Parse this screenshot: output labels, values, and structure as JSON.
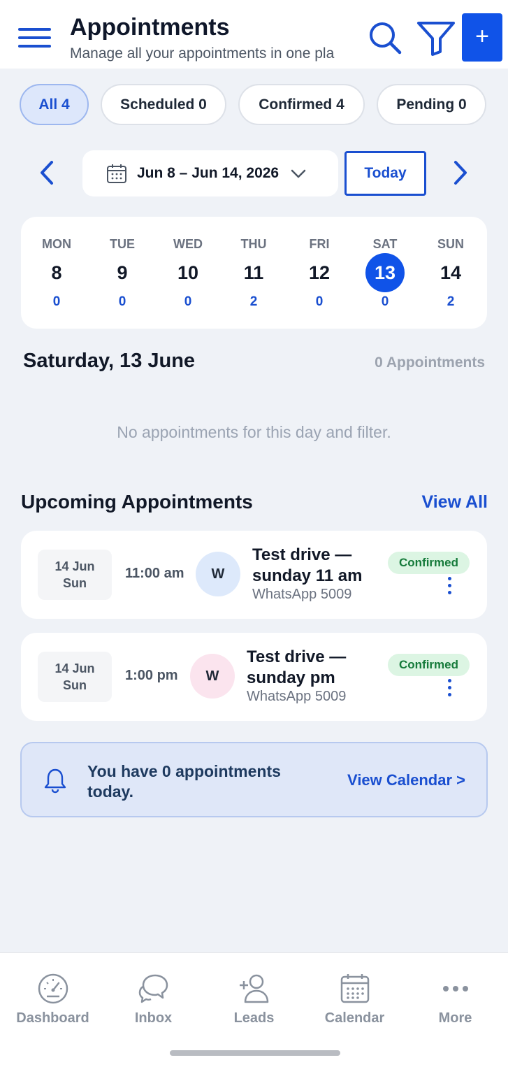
{
  "header": {
    "title": "Appointments",
    "subtitle": "Manage all your appointments in one pla",
    "add_label": "+"
  },
  "filters": [
    {
      "label": "All 4",
      "active": true
    },
    {
      "label": "Scheduled 0",
      "active": false
    },
    {
      "label": "Confirmed 4",
      "active": false
    },
    {
      "label": "Pending 0",
      "active": false
    }
  ],
  "date_nav": {
    "range": "Jun 8 – Jun 14, 2026",
    "today_label": "Today"
  },
  "week": [
    {
      "name": "MON",
      "num": "8",
      "count": "0"
    },
    {
      "name": "TUE",
      "num": "9",
      "count": "0"
    },
    {
      "name": "WED",
      "num": "10",
      "count": "0"
    },
    {
      "name": "THU",
      "num": "11",
      "count": "2"
    },
    {
      "name": "FRI",
      "num": "12",
      "count": "0"
    },
    {
      "name": "SAT",
      "num": "13",
      "count": "0",
      "selected": true
    },
    {
      "name": "SUN",
      "num": "14",
      "count": "2"
    }
  ],
  "selected_day": {
    "title": "Saturday, 13 June",
    "count_label": "0 Appointments",
    "empty_message": "No appointments for this day and filter."
  },
  "upcoming": {
    "title": "Upcoming Appointments",
    "view_all": "View All",
    "items": [
      {
        "date": "14 Jun",
        "weekday": "Sun",
        "time": "11:00 am",
        "avatar": "W",
        "avatar_color": "#dde9fb",
        "title": "Test drive — sunday 11 am",
        "channel": "WhatsApp 5009",
        "status": "Confirmed"
      },
      {
        "date": "14 Jun",
        "weekday": "Sun",
        "time": "1:00 pm",
        "avatar": "W",
        "avatar_color": "#fbe4ee",
        "title": "Test drive — sunday pm",
        "channel": "WhatsApp 5009",
        "status": "Confirmed"
      }
    ]
  },
  "banner": {
    "text": "You have 0 appointments today.",
    "link": "View Calendar >"
  },
  "bottom_nav": [
    {
      "label": "Dashboard",
      "icon": "speedometer-icon"
    },
    {
      "label": "Inbox",
      "icon": "chat-bubbles-icon"
    },
    {
      "label": "Leads",
      "icon": "add-user-icon"
    },
    {
      "label": "Calendar",
      "icon": "calendar-icon"
    },
    {
      "label": "More",
      "icon": "more-dots-icon"
    }
  ],
  "colors": {
    "accent": "#1053e8",
    "confirmed_bg": "#dcf5e3",
    "confirmed_text": "#157a3a"
  }
}
